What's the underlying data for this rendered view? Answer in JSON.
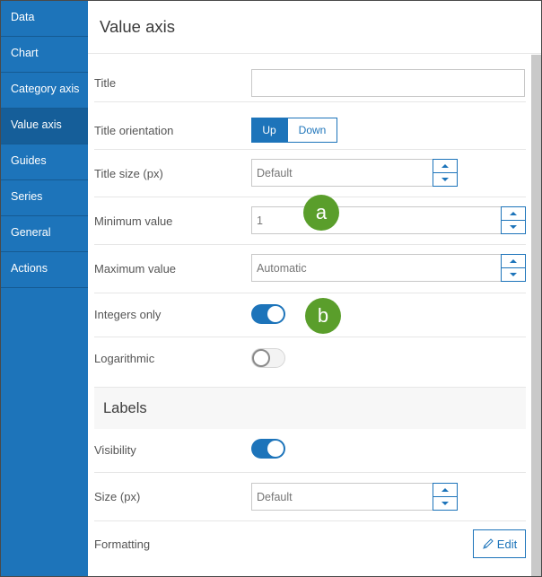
{
  "sidebar": {
    "items": [
      {
        "label": "Data"
      },
      {
        "label": "Chart"
      },
      {
        "label": "Category axis"
      },
      {
        "label": "Value axis",
        "active": true
      },
      {
        "label": "Guides"
      },
      {
        "label": "Series"
      },
      {
        "label": "General"
      },
      {
        "label": "Actions"
      }
    ]
  },
  "header": {
    "title": "Value axis"
  },
  "form": {
    "title": {
      "label": "Title",
      "value": "",
      "placeholder": ""
    },
    "title_orientation": {
      "label": "Title orientation",
      "options": [
        "Up",
        "Down"
      ],
      "selected": "Up"
    },
    "title_size": {
      "label": "Title size (px)",
      "value": "",
      "placeholder": "Default"
    },
    "minimum_value": {
      "label": "Minimum value",
      "value": "1",
      "placeholder": ""
    },
    "maximum_value": {
      "label": "Maximum value",
      "value": "",
      "placeholder": "Automatic"
    },
    "integers_only": {
      "label": "Integers only",
      "checked": true
    },
    "logarithmic": {
      "label": "Logarithmic",
      "checked": false
    }
  },
  "labels_section": {
    "heading": "Labels",
    "visibility": {
      "label": "Visibility",
      "checked": true
    },
    "size": {
      "label": "Size (px)",
      "value": "",
      "placeholder": "Default"
    },
    "formatting": {
      "label": "Formatting",
      "button_label": "Edit"
    }
  },
  "callouts": {
    "a": "a",
    "b": "b"
  },
  "colors": {
    "accent": "#1d74ba",
    "sidebar_active": "#155e99",
    "callout": "#5a9e2b"
  }
}
